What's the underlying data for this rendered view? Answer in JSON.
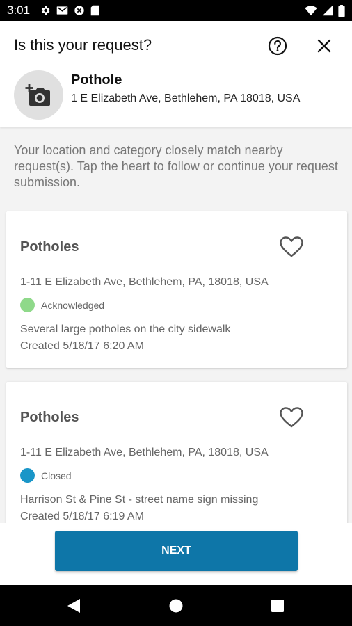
{
  "status_bar": {
    "time": "3:01",
    "left_icons": [
      "settings-icon",
      "gmail-icon",
      "sync-icon",
      "sd-card-icon"
    ],
    "right_icons": [
      "wifi-icon",
      "signal-icon",
      "battery-icon"
    ]
  },
  "header": {
    "title": "Is this your request?",
    "help_icon": "help-circle-icon",
    "close_icon": "close-icon",
    "photo_icon": "add-photo-icon",
    "category": "Pothole",
    "address": "1 E Elizabeth Ave, Bethlehem, PA 18018, USA"
  },
  "info_text": "Your location and category closely match nearby request(s). Tap the heart to follow or continue your request submission.",
  "requests": [
    {
      "title": "Potholes",
      "address": "1-11 E Elizabeth Ave, Bethlehem, PA, 18018, USA",
      "status": "Acknowledged",
      "status_color": "#8fd98a",
      "description": "Several large potholes on the city sidewalk",
      "created": "Created 5/18/17 6:20 AM"
    },
    {
      "title": "Potholes",
      "address": "1-11 E Elizabeth Ave, Bethlehem, PA, 18018, USA",
      "status": "Closed",
      "status_color": "#1a96c8",
      "description": "Harrison St & Pine St - street name sign missing",
      "created": "Created 5/18/17 6:19 AM"
    }
  ],
  "footer": {
    "next_label": "NEXT",
    "accent": "#0e76a8"
  },
  "nav_bar": {
    "icons": [
      "back-icon",
      "home-icon",
      "recents-icon"
    ]
  }
}
